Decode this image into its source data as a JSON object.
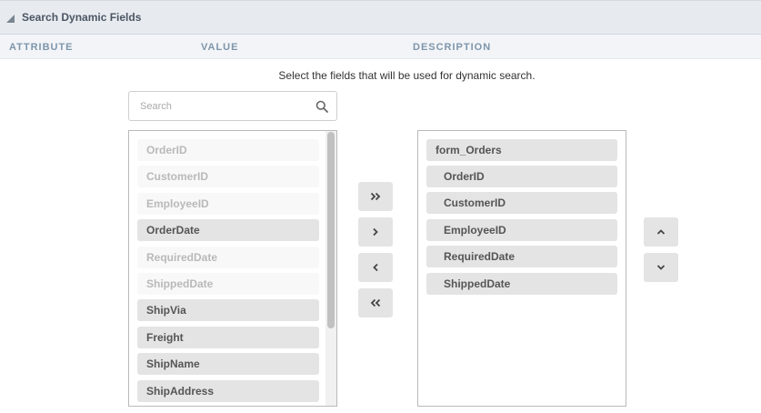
{
  "section": {
    "title": "Search Dynamic Fields"
  },
  "columns": {
    "attribute": "ATTRIBUTE",
    "value": "VALUE",
    "description": "DESCRIPTION"
  },
  "instruction": "Select the fields that will be used for dynamic search.",
  "search": {
    "placeholder": "Search",
    "value": ""
  },
  "available_fields": [
    {
      "label": "OrderID",
      "state": "disabled"
    },
    {
      "label": "CustomerID",
      "state": "disabled"
    },
    {
      "label": "EmployeeID",
      "state": "disabled"
    },
    {
      "label": "OrderDate",
      "state": "active"
    },
    {
      "label": "RequiredDate",
      "state": "disabled"
    },
    {
      "label": "ShippedDate",
      "state": "disabled"
    },
    {
      "label": "ShipVia",
      "state": "active"
    },
    {
      "label": "Freight",
      "state": "active"
    },
    {
      "label": "ShipName",
      "state": "active"
    },
    {
      "label": "ShipAddress",
      "state": "active"
    }
  ],
  "selected_fields": {
    "group": "form_Orders",
    "items": [
      "OrderID",
      "CustomerID",
      "EmployeeID",
      "RequiredDate",
      "ShippedDate"
    ]
  },
  "buttons": {
    "move_all_right": "chevrons-right-icon",
    "move_right": "chevron-right-icon",
    "move_left": "chevron-left-icon",
    "move_all_left": "chevrons-left-icon",
    "move_up": "chevron-up-icon",
    "move_down": "chevron-down-icon"
  },
  "colors": {
    "header_bg": "#e7ebf0",
    "column_text": "#7e96ab",
    "item_bg": "#e4e4e4",
    "disabled_text": "#b9b9b9"
  }
}
